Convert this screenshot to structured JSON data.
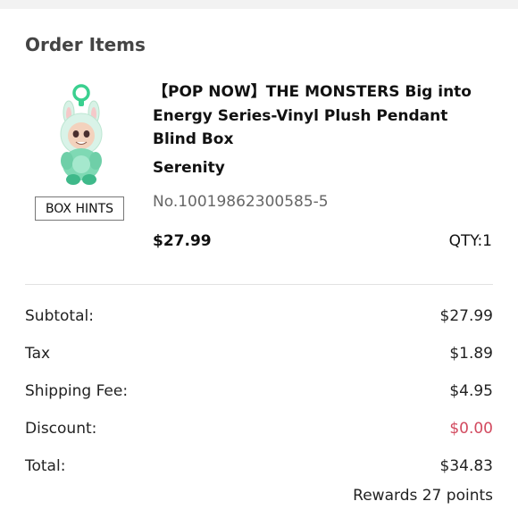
{
  "section": {
    "title": "Order Items"
  },
  "item": {
    "image_icon": "monster-plush-pendant-image",
    "box_hints_label": "BOX HINTS",
    "name": "【POP NOW】THE MONSTERS Big into Energy Series-Vinyl Plush Pendant Blind Box",
    "variant": "Serenity",
    "sku": "No.10019862300585-5",
    "price": "$27.99",
    "qty": "QTY:1"
  },
  "summary": {
    "subtotal": {
      "label": "Subtotal:",
      "value": "$27.99"
    },
    "tax": {
      "label": "Tax",
      "value": "$1.89"
    },
    "shipping": {
      "label": "Shipping Fee:",
      "value": "$4.95"
    },
    "discount": {
      "label": "Discount:",
      "value": "$0.00"
    },
    "total": {
      "label": "Total:",
      "value": "$34.83"
    },
    "rewards": "Rewards 27 points"
  },
  "colors": {
    "discount": "#d24a5f",
    "topbar": "#f2f2f2",
    "divider": "#e2e2e2"
  }
}
